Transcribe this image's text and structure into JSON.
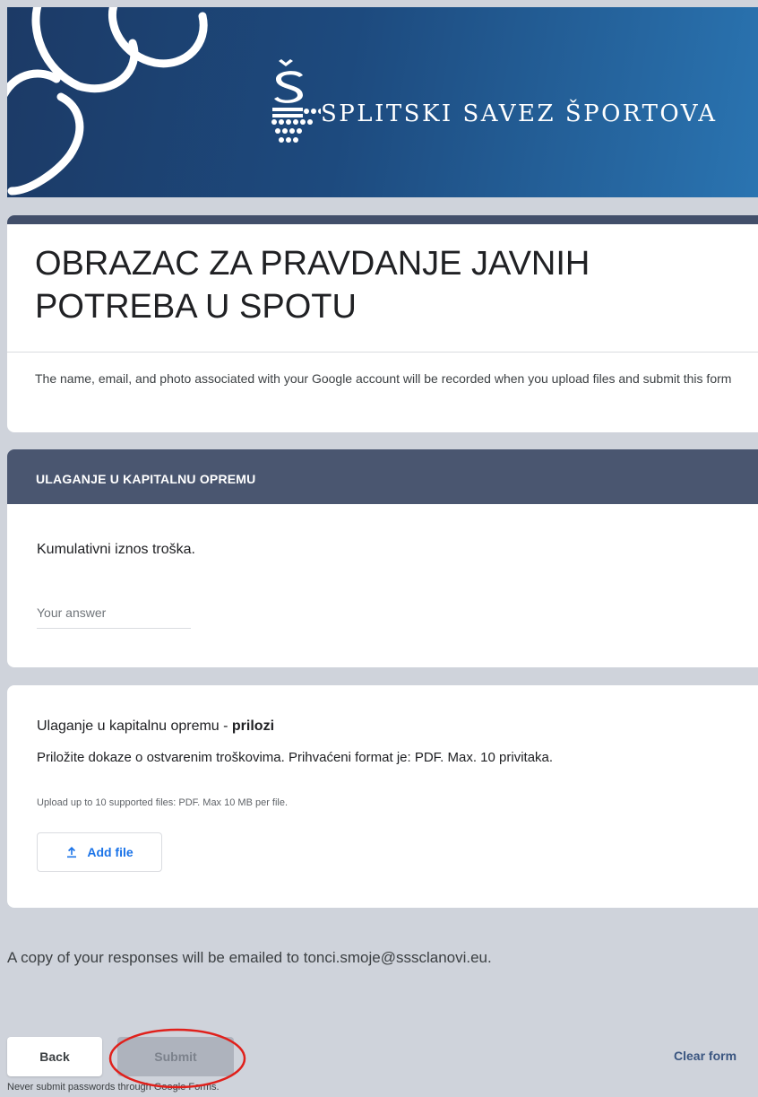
{
  "header": {
    "org_name": "SPLITSKI SAVEZ ŠPORTOVA",
    "colors": {
      "banner_dark": "#1c3a66",
      "banner_light": "#2a74b1"
    }
  },
  "form": {
    "title": "OBRAZAC ZA PRAVDANJE JAVNIH POTREBA U SPOTU",
    "account_notice": "The name, email, and photo associated with your Google account will be recorded when you upload files and submit this form"
  },
  "section": {
    "title": "ULAGANJE U KAPITALNU OPREMU"
  },
  "question1": {
    "label": "Kumulativni iznos troška.",
    "placeholder": "Your answer",
    "value": ""
  },
  "question2": {
    "label_prefix": "Ulaganje u kapitalnu opremu - ",
    "label_bold": "prilozi",
    "description": "Priložite dokaze o ostvarenim troškovima. Prihvaćeni format je: PDF. Max. 10 privitaka.",
    "upload_hint": "Upload up to 10 supported files: PDF. Max 10 MB per file.",
    "add_file_label": "Add file",
    "add_file_icon": "upload-icon"
  },
  "footer": {
    "copy_notice": "A copy of your responses will be emailed to tonci.smoje@sssclanovi.eu.",
    "back_label": "Back",
    "submit_label": "Submit",
    "clear_label": "Clear form",
    "password_warning": "Never submit passwords through Google Forms.",
    "annotation_color": "#e0201b"
  }
}
